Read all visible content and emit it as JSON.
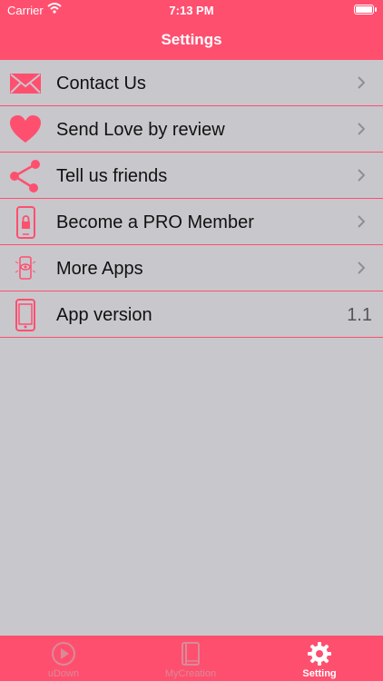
{
  "status": {
    "carrier": "Carrier",
    "time": "7:13 PM"
  },
  "header": {
    "title": "Settings"
  },
  "items": [
    {
      "label": "Contact Us",
      "icon": "envelope-icon"
    },
    {
      "label": "Send Love by review",
      "icon": "heart-icon"
    },
    {
      "label": "Tell us friends",
      "icon": "share-icon"
    },
    {
      "label": "Become a PRO Member",
      "icon": "phone-lock-icon"
    },
    {
      "label": "More Apps",
      "icon": "phone-apps-icon"
    },
    {
      "label": "App version",
      "icon": "phone-icon",
      "value": "1.1"
    }
  ],
  "tabs": [
    {
      "label": "uDown",
      "icon": "play-circle-icon"
    },
    {
      "label": "MyCreation",
      "icon": "book-icon"
    },
    {
      "label": "Setting",
      "icon": "gear-icon",
      "active": true
    }
  ],
  "colors": {
    "accent": "#ff4f6f",
    "background": "#c8c7cc"
  }
}
